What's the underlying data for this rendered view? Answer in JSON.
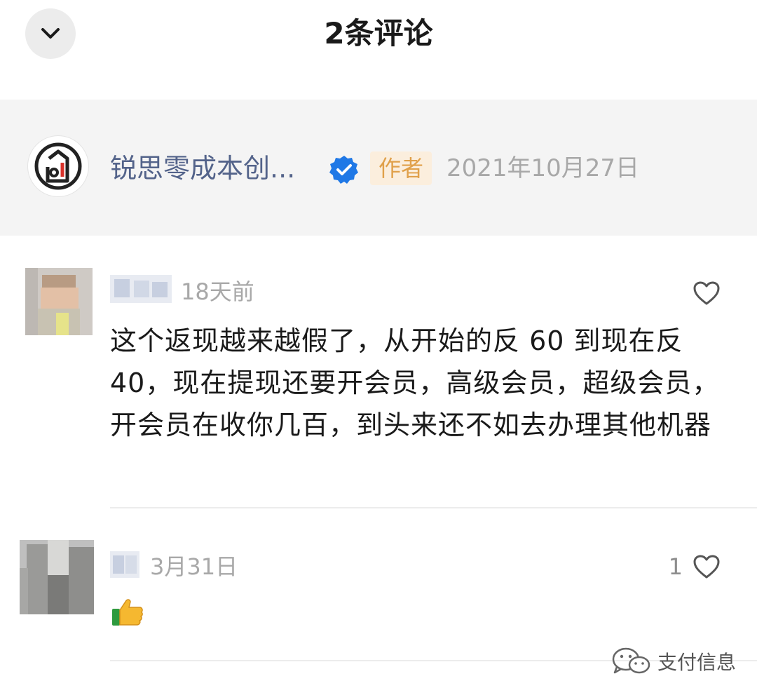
{
  "header": {
    "title": "2条评论",
    "collapse_icon": "chevron-down-icon"
  },
  "author": {
    "name": "锐思零成本创...",
    "tag": "作者",
    "date": "2021年10月27日",
    "verified_icon": "verified-badge-icon"
  },
  "comments": [
    {
      "time": "18天前",
      "text": "这个返现越来越假了，从开始的反 60 到现在反 40，现在提现还要开会员，高级会员，超级会员，开会员在收你几百，到头来还不如去办理其他机器",
      "like_count": "",
      "like_icon": "heart-outline-icon"
    },
    {
      "time": "3月31日",
      "text": "",
      "emoji": "thumbs-up-emoji",
      "like_count": "1",
      "like_icon": "heart-outline-icon"
    }
  ],
  "watermark": {
    "text": "支付信息",
    "icon": "wechat-icon"
  },
  "colors": {
    "author_name": "#53638a",
    "tag_bg": "#fbeedd",
    "tag_text": "#e0a04a",
    "verified": "#1f78e6",
    "muted": "#a8a8a8"
  }
}
